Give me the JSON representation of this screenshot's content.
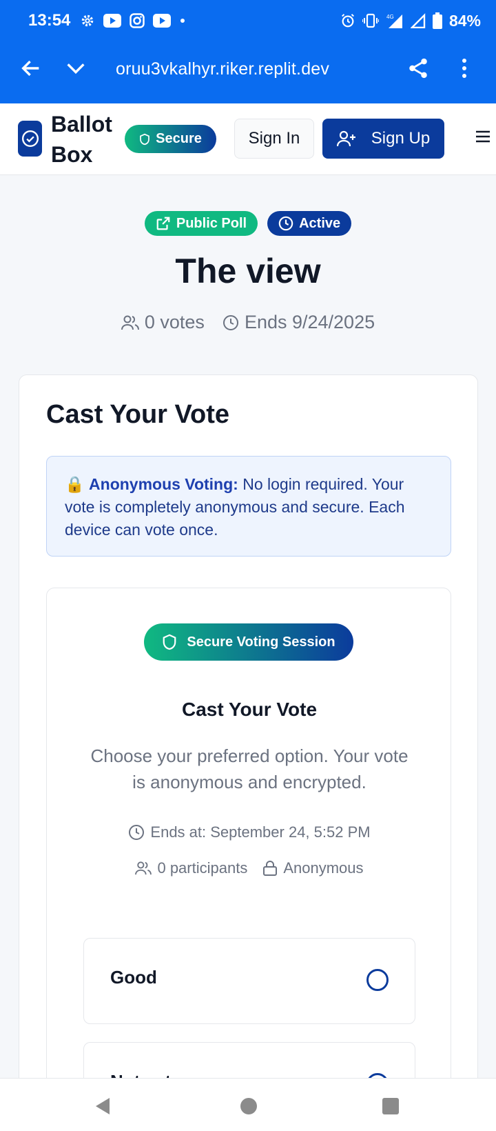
{
  "status_bar": {
    "time": "13:54",
    "battery": "84%",
    "network": "4G"
  },
  "browser": {
    "url": "oruu3vkalhyr.riker.replit.dev"
  },
  "header": {
    "brand_line1": "Ballot",
    "brand_line2": "Box",
    "secure_label": "Secure",
    "sign_in": "Sign In",
    "sign_up": "Sign Up"
  },
  "poll": {
    "badge_public": "Public Poll",
    "badge_active": "Active",
    "title": "The view",
    "votes": "0 votes",
    "ends": "Ends 9/24/2025"
  },
  "card": {
    "title": "Cast Your Vote",
    "notice_lead": "Anonymous Voting:",
    "notice_text": "No login required. Your vote is completely anonymous and secure. Each device can vote once.",
    "notice_icon": "🔒",
    "session_label": "Secure Voting Session",
    "inner_title": "Cast Your Vote",
    "inner_desc": "Choose your preferred option. Your vote is anonymous and encrypted.",
    "ends_at": "Ends at: September 24, 5:52 PM",
    "participants": "0 participants",
    "anonymous": "Anonymous",
    "options": [
      {
        "label": "Good",
        "selected": false
      },
      {
        "label": "Not yet",
        "selected": false
      }
    ]
  },
  "colors": {
    "brand_blue": "#0b3b9c",
    "accent_green": "#10b981",
    "browser_bar": "#0a6cf0"
  }
}
